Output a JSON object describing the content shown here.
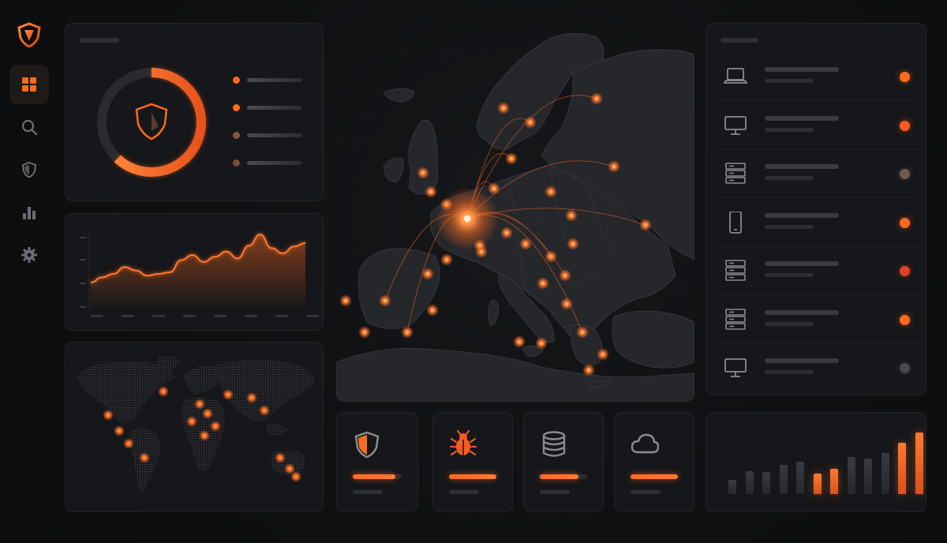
{
  "colors": {
    "accent": "#ff6a1f",
    "accent_bright": "#ff8a3a",
    "red": "#e0402a",
    "muted": "#6b5a52",
    "gray": "#4a4a4e",
    "panel_bg": "#18191c"
  },
  "sidebar": {
    "items": [
      {
        "icon": "dashboard-grid-icon",
        "active": true
      },
      {
        "icon": "search-icon",
        "active": false
      },
      {
        "icon": "shield-icon",
        "active": false
      },
      {
        "icon": "bar-chart-icon",
        "active": false
      },
      {
        "icon": "gear-icon",
        "active": false
      }
    ]
  },
  "donut": {
    "progress": 0.62,
    "legend": [
      {
        "color": "#ff6a1f"
      },
      {
        "color": "#ff6a1f"
      },
      {
        "color": "#8a5540"
      },
      {
        "color": "#7a4a3a"
      }
    ]
  },
  "line_chart": {
    "values": [
      12,
      18,
      22,
      30,
      26,
      20,
      22,
      24,
      38,
      44,
      36,
      42,
      48,
      40,
      55,
      68,
      52,
      46,
      54,
      58
    ]
  },
  "world_map": {
    "hotspots": 16
  },
  "tiles": [
    {
      "icon": "shield-half-icon",
      "progress": 0.87
    },
    {
      "icon": "bug-icon",
      "progress": 1.0
    },
    {
      "icon": "database-icon",
      "progress": 0.82
    },
    {
      "icon": "cloud-icon",
      "progress": 1.0
    }
  ],
  "devices": [
    {
      "icon": "laptop-icon",
      "status_color": "#ff6a1f"
    },
    {
      "icon": "monitor-icon",
      "status_color": "#ff5a24"
    },
    {
      "icon": "server-icon",
      "status_color": "#6b5a52"
    },
    {
      "icon": "phone-icon",
      "status_color": "#ff6a1f"
    },
    {
      "icon": "server-icon",
      "status_color": "#e0402a"
    },
    {
      "icon": "server-icon",
      "status_color": "#ff6a1f"
    },
    {
      "icon": "monitor-icon",
      "status_color": "#4a4a4e"
    }
  ],
  "bar_chart": {
    "values": [
      22,
      36,
      34,
      46,
      50,
      32,
      40,
      58,
      56,
      64,
      80,
      96
    ],
    "highlight": [
      false,
      false,
      false,
      false,
      false,
      true,
      true,
      false,
      false,
      false,
      true,
      true
    ]
  }
}
